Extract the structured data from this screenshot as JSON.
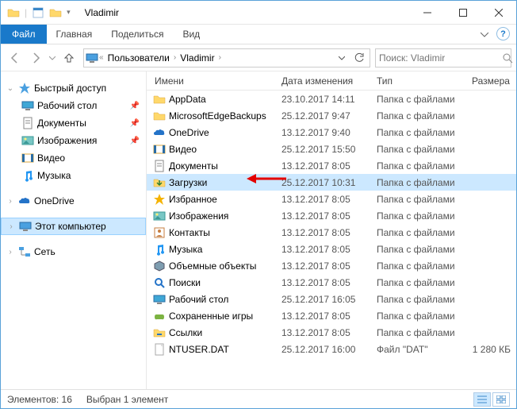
{
  "window": {
    "title": "Vladimir"
  },
  "ribbon": {
    "file": "Файл",
    "tabs": [
      "Главная",
      "Поделиться",
      "Вид"
    ]
  },
  "breadcrumb": {
    "root_icon": "pc",
    "segments": [
      "Пользователи",
      "Vladimir"
    ]
  },
  "search": {
    "placeholder": "Поиск: Vladimir"
  },
  "nav": {
    "quick": {
      "label": "Быстрый доступ",
      "items": [
        {
          "label": "Рабочий стол",
          "icon": "desktop",
          "pin": true
        },
        {
          "label": "Документы",
          "icon": "docs",
          "pin": true
        },
        {
          "label": "Изображения",
          "icon": "pics",
          "pin": true
        },
        {
          "label": "Видео",
          "icon": "video",
          "pin": false
        },
        {
          "label": "Музыка",
          "icon": "music",
          "pin": false
        }
      ]
    },
    "onedrive": "OneDrive",
    "thispc": "Этот компьютер",
    "network": "Сеть"
  },
  "columns": {
    "name": "Имени",
    "date": "Дата изменения",
    "type": "Тип",
    "size": "Размера"
  },
  "files": [
    {
      "name": "AppData",
      "date": "23.10.2017 14:11",
      "type": "Папка с файлами",
      "size": "",
      "icon": "folder"
    },
    {
      "name": "MicrosoftEdgeBackups",
      "date": "25.12.2017 9:47",
      "type": "Папка с файлами",
      "size": "",
      "icon": "folder"
    },
    {
      "name": "OneDrive",
      "date": "13.12.2017 9:40",
      "type": "Папка с файлами",
      "size": "",
      "icon": "onedrive"
    },
    {
      "name": "Видео",
      "date": "25.12.2017 15:50",
      "type": "Папка с файлами",
      "size": "",
      "icon": "video"
    },
    {
      "name": "Документы",
      "date": "13.12.2017 8:05",
      "type": "Папка с файлами",
      "size": "",
      "icon": "docs"
    },
    {
      "name": "Загрузки",
      "date": "25.12.2017 10:31",
      "type": "Папка с файлами",
      "size": "",
      "icon": "downloads",
      "selected": true
    },
    {
      "name": "Избранное",
      "date": "13.12.2017 8:05",
      "type": "Папка с файлами",
      "size": "",
      "icon": "favorites"
    },
    {
      "name": "Изображения",
      "date": "13.12.2017 8:05",
      "type": "Папка с файлами",
      "size": "",
      "icon": "pics"
    },
    {
      "name": "Контакты",
      "date": "13.12.2017 8:05",
      "type": "Папка с файлами",
      "size": "",
      "icon": "contacts"
    },
    {
      "name": "Музыка",
      "date": "13.12.2017 8:05",
      "type": "Папка с файлами",
      "size": "",
      "icon": "music"
    },
    {
      "name": "Объемные объекты",
      "date": "13.12.2017 8:05",
      "type": "Папка с файлами",
      "size": "",
      "icon": "3d"
    },
    {
      "name": "Поиски",
      "date": "13.12.2017 8:05",
      "type": "Папка с файлами",
      "size": "",
      "icon": "search"
    },
    {
      "name": "Рабочий стол",
      "date": "25.12.2017 16:05",
      "type": "Папка с файлами",
      "size": "",
      "icon": "desktop"
    },
    {
      "name": "Сохраненные игры",
      "date": "13.12.2017 8:05",
      "type": "Папка с файлами",
      "size": "",
      "icon": "games"
    },
    {
      "name": "Ссылки",
      "date": "13.12.2017 8:05",
      "type": "Папка с файлами",
      "size": "",
      "icon": "links"
    },
    {
      "name": "NTUSER.DAT",
      "date": "25.12.2017 16:00",
      "type": "Файл \"DAT\"",
      "size": "1 280 КБ",
      "icon": "file"
    }
  ],
  "status": {
    "count_label": "Элементов: 16",
    "selection_label": "Выбран 1 элемент"
  }
}
